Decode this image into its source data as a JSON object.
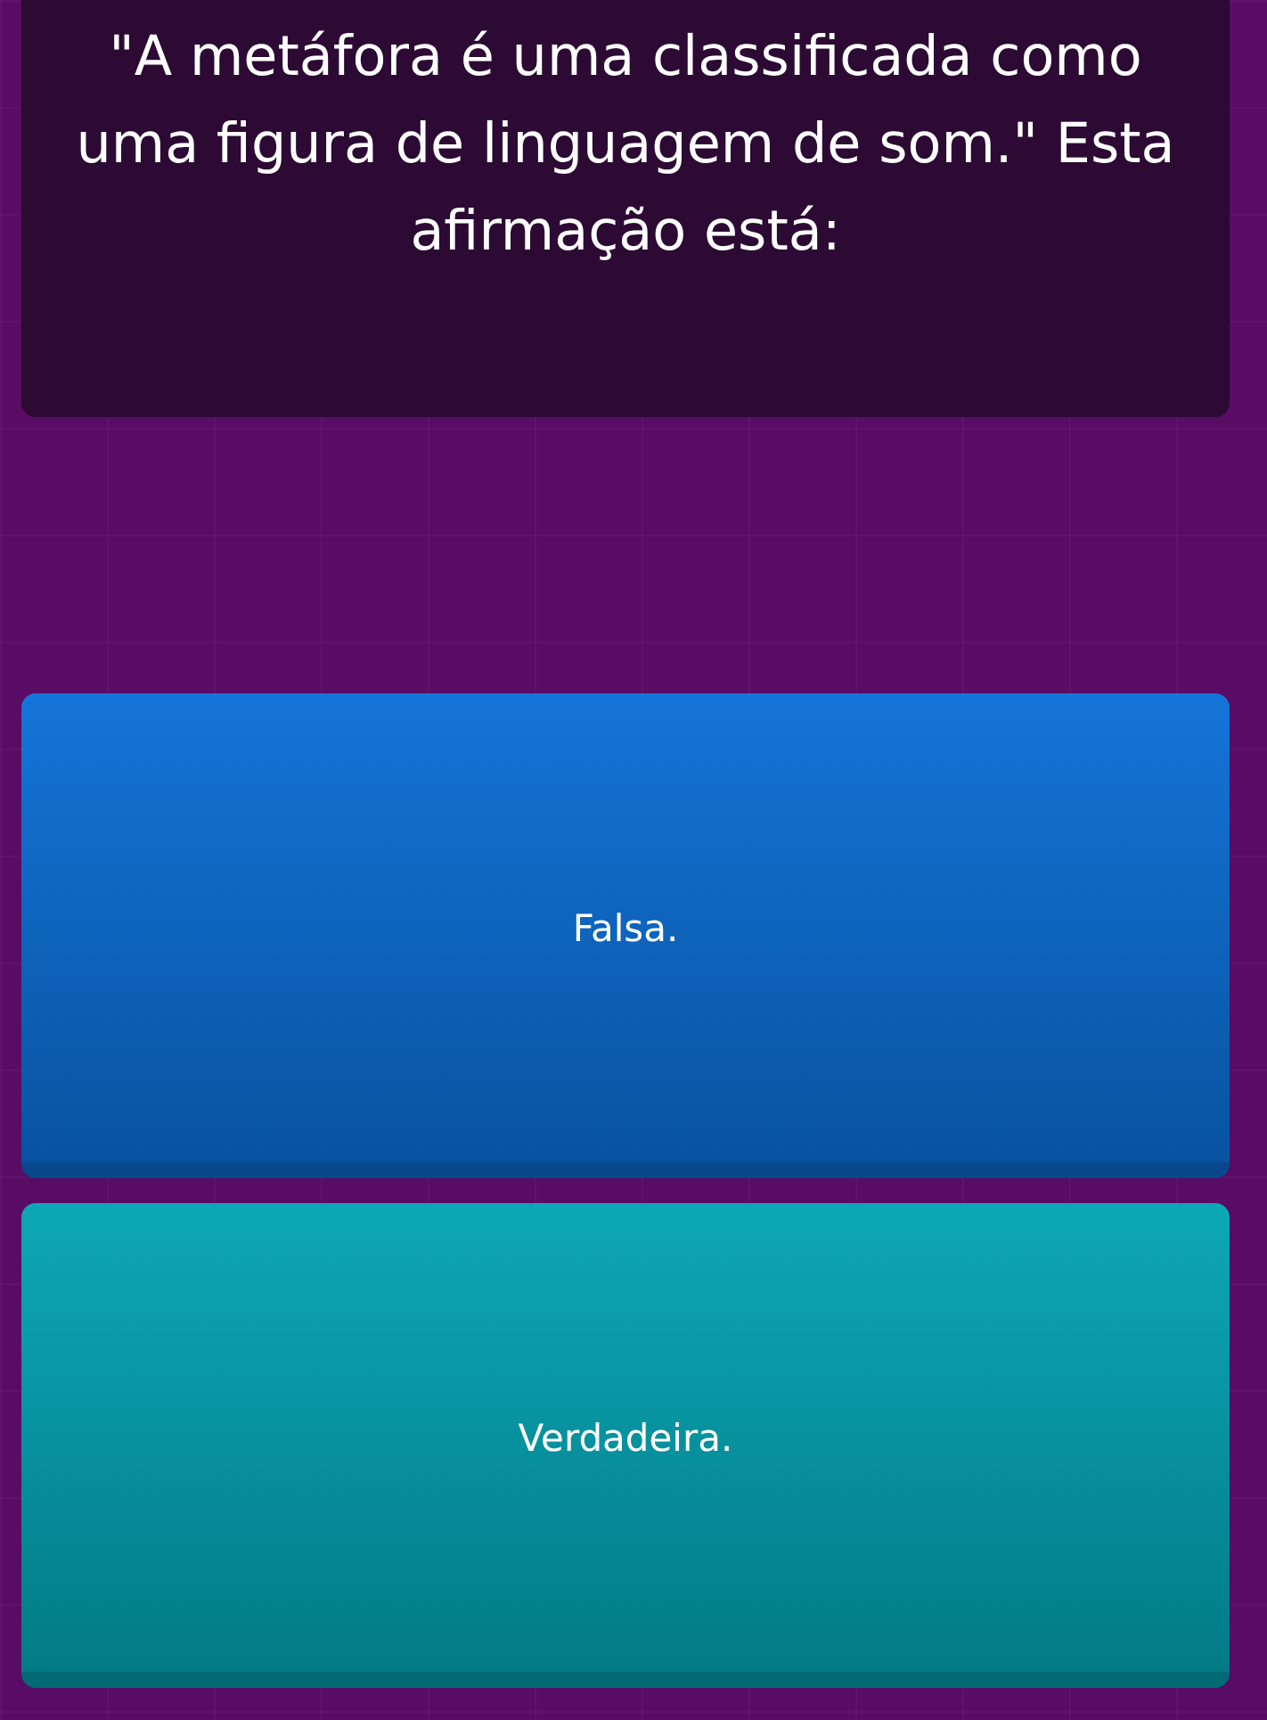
{
  "question": {
    "text": "\"A metáfora é uma classificada como uma figura de linguagem de som.\" Esta afirmação está:"
  },
  "answers": [
    {
      "label": "Falsa.",
      "color": "#0b6fd6"
    },
    {
      "label": "Verdadeira.",
      "color": "#03a4b4"
    }
  ]
}
